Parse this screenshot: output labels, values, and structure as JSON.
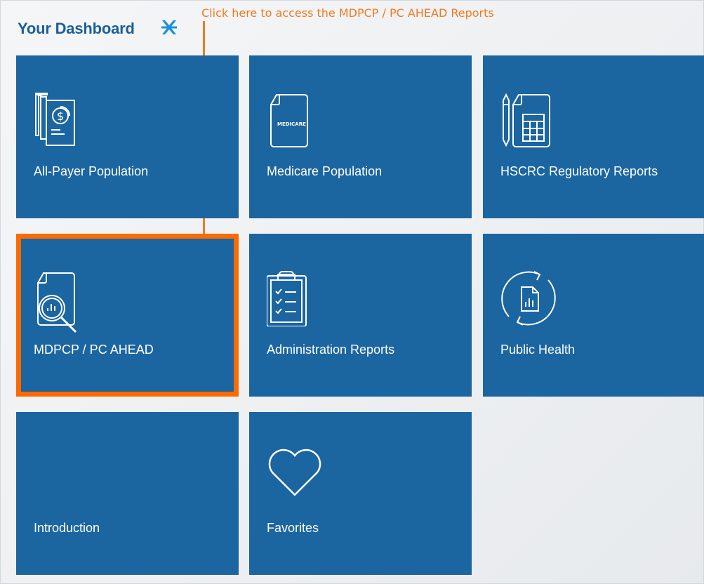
{
  "dashboard": {
    "title": "Your Dashboard",
    "pin_icon": "pin-tool-icon"
  },
  "annotation": {
    "text": "Click here to access the MDPCP / PC AHEAD Reports",
    "color": "#f07a20",
    "highlight_color": "#ff6a00"
  },
  "tiles": [
    {
      "label": "All-Payer Population",
      "icon": "dollar-documents-icon"
    },
    {
      "label": "Medicare Population",
      "icon": "medicare-document-icon",
      "icon_text": "MEDICARE"
    },
    {
      "label": "HSCRC Regulatory Reports",
      "icon": "pencil-calculator-icon"
    },
    {
      "label": "MDPCP / PC AHEAD",
      "icon": "report-magnifier-chart-icon",
      "highlighted": true
    },
    {
      "label": "Administration Reports",
      "icon": "clipboard-checklist-icon"
    },
    {
      "label": "Public Health",
      "icon": "refresh-report-icon"
    },
    {
      "label": "Introduction",
      "icon": ""
    },
    {
      "label": "Favorites",
      "icon": "heart-icon"
    }
  ],
  "colors": {
    "tile": "#1b65a0",
    "title": "#1c5f98",
    "background": "#eef0f2"
  }
}
